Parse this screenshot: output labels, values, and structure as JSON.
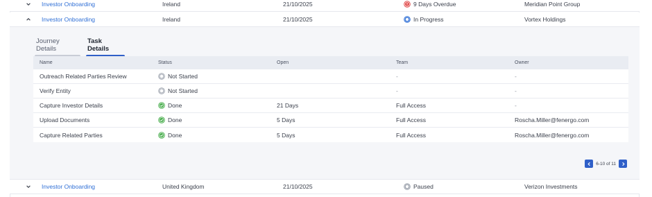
{
  "rows": [
    {
      "name": "Investor Onboarding",
      "country": "Ireland",
      "date": "21/10/2025",
      "status": "9 Days Overdue",
      "client": "Meridian Point Group"
    },
    {
      "name": "Investor Onboarding",
      "country": "Ireland",
      "date": "21/10/2025",
      "status": "In Progress",
      "client": "Vortex Holdings"
    },
    {
      "name": "Investor Onboarding",
      "country": "United Kingdom",
      "date": "21/10/2025",
      "status": "Paused",
      "client": "Verizon Investments"
    }
  ],
  "tabs": {
    "journey": "Journey Details",
    "task": "Task Details"
  },
  "task_table": {
    "headers": {
      "name": "Name",
      "status": "Status",
      "open": "Open",
      "team": "Team",
      "owner": "Owner"
    },
    "rows": [
      {
        "name": "Outreach Related Parties Review",
        "status": "Not Started",
        "open": "",
        "team": "-",
        "owner": "-"
      },
      {
        "name": "Verify Entity",
        "status": "Not Started",
        "open": "",
        "team": "-",
        "owner": "-"
      },
      {
        "name": "Capture Investor Details",
        "status": "Done",
        "open": "21 Days",
        "team": "Full Access",
        "owner": "-"
      },
      {
        "name": "Upload Documents",
        "status": "Done",
        "open": "5 Days",
        "team": "Full Access",
        "owner": "Roscha.Miller@fenergo.com"
      },
      {
        "name": "Capture Related Parties",
        "status": "Done",
        "open": "5 Days",
        "team": "Full Access",
        "owner": "Roscha.Miller@fenergo.com"
      }
    ]
  },
  "pager": {
    "label": "6-10 of 11"
  },
  "colors": {
    "link": "#2f6fd6",
    "accent": "#2f5fc8",
    "overdue": "#e04848",
    "done": "#4caf50",
    "neutral": "#9aa0ab"
  }
}
